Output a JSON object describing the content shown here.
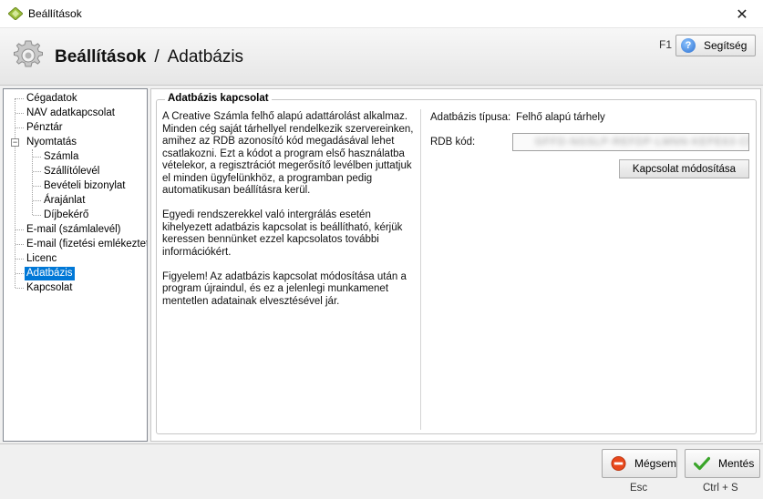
{
  "window": {
    "title": "Beállítások",
    "close_glyph": "✕"
  },
  "header": {
    "section": "Beállítások",
    "separator": "/",
    "page": "Adatbázis",
    "f1_label": "F1",
    "help_label": "Segítség",
    "help_icon_glyph": "?"
  },
  "tree": {
    "items": [
      {
        "label": "Cégadatok",
        "level": 0
      },
      {
        "label": "NAV adatkapcsolat",
        "level": 0
      },
      {
        "label": "Pénztár",
        "level": 0
      },
      {
        "label": "Nyomtatás",
        "level": 0,
        "expanded": true,
        "expander_glyph": "−"
      },
      {
        "label": "Számla",
        "level": 1
      },
      {
        "label": "Szállítólevél",
        "level": 1
      },
      {
        "label": "Bevételi bizonylat",
        "level": 1
      },
      {
        "label": "Árajánlat",
        "level": 1
      },
      {
        "label": "Díjbekérő",
        "level": 1
      },
      {
        "label": "E-mail (számlalevél)",
        "level": 0
      },
      {
        "label": "E-mail (fizetési emlékeztető)",
        "level": 0
      },
      {
        "label": "Licenc",
        "level": 0
      },
      {
        "label": "Adatbázis",
        "level": 0,
        "selected": true
      },
      {
        "label": "Kapcsolat",
        "level": 0
      }
    ]
  },
  "group": {
    "title": "Adatbázis kapcsolat",
    "paragraphs": [
      "A Creative Számla felhő alapú adattárolást alkalmaz. Minden cég saját tárhellyel rendelkezik szervereinken, amihez az RDB azonosító kód megadásával lehet csatlakozni. Ezt a kódot a program első használatba vételekor, a regisztrációt megerősítő levélben juttatjuk el minden ügyfelünkhöz, a programban pedig automatikusan beállításra kerül.",
      "Egyedi rendszerekkel való intergrálás esetén kihelyezett adatbázis kapcsolat is beállítható, kérjük keressen bennünket ezzel kapcsolatos további információkért.",
      "Figyelem! Az adatbázis kapcsolat módosítása után a program újraindul, és ez a jelenlegi munkamenet mentetlen adatainak elvesztésével jár."
    ],
    "type_label": "Adatbázis típusa:",
    "type_value": "Felhő alapú tárhely",
    "rdb_label": "RDB kód:",
    "rdb_value": "GFFD-NGSLP-REFDP-LMNN-KEPE63-CFNEL",
    "modify_button": "Kapcsolat módosítása"
  },
  "footer": {
    "cancel_label": "Mégsem",
    "cancel_shortcut": "Esc",
    "save_label": "Mentés",
    "save_shortcut": "Ctrl + S"
  },
  "colors": {
    "selection": "#0078d7",
    "cancel_icon": "#e8481c",
    "save_icon": "#3aa52a",
    "help_icon": "#2b6fd0"
  }
}
